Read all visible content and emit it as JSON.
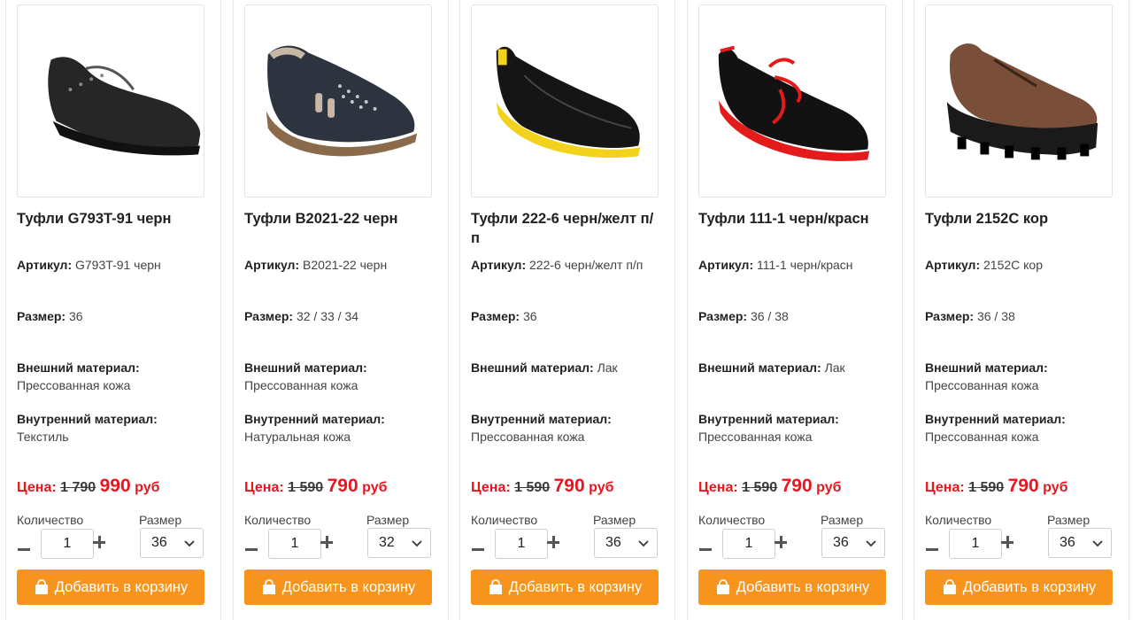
{
  "labels": {
    "article": "Артикул:",
    "size": "Размер:",
    "outer_material": "Внешний материал:",
    "inner_material": "Внутренний материал:",
    "price": "Цена:",
    "currency": "руб",
    "quantity": "Количество",
    "size_select": "Размер",
    "add_to_cart": "Добавить в корзину"
  },
  "colors": {
    "accent": "#f7941d",
    "price_red": "#e8161e"
  },
  "products": [
    {
      "title": "Туфли G793T-91 черн",
      "article": "G793T-91 черн",
      "sizes": "36",
      "outer_material": "Прессованная кожа",
      "inner_material": "Текстиль",
      "old_price": "1 790",
      "new_price": "990",
      "quantity": "1",
      "selected_size": "36",
      "image": "black-leather-lace-up-shoe"
    },
    {
      "title": "Туфли B2021-22 черн",
      "article": "B2021-22 черн",
      "sizes": "32 / 33 / 34",
      "outer_material": "Прессованная кожа",
      "inner_material": "Натуральная кожа",
      "old_price": "1 590",
      "new_price": "790",
      "quantity": "1",
      "selected_size": "32",
      "image": "black-perforated-slip-on-shoe"
    },
    {
      "title": "Туфли 222-6 черн/желт п/п",
      "article": "222-6 черн/желт п/п",
      "sizes": "36",
      "outer_material": "Лак",
      "inner_material": "Прессованная кожа",
      "old_price": "1 590",
      "new_price": "790",
      "quantity": "1",
      "selected_size": "36",
      "image": "black-patent-shoe-yellow-sole"
    },
    {
      "title": "Туфли 111-1 черн/красн",
      "article": "111-1 черн/красн",
      "sizes": "36 / 38",
      "outer_material": "Лак",
      "inner_material": "Прессованная кожа",
      "old_price": "1 590",
      "new_price": "790",
      "quantity": "1",
      "selected_size": "36",
      "image": "black-patent-shoe-red-laces"
    },
    {
      "title": "Туфли 2152C кор",
      "article": "2152C кор",
      "sizes": "36 / 38",
      "outer_material": "Прессованная кожа",
      "inner_material": "Прессованная кожа",
      "old_price": "1 590",
      "new_price": "790",
      "quantity": "1",
      "selected_size": "36",
      "image": "brown-chunky-sole-shoe"
    }
  ]
}
